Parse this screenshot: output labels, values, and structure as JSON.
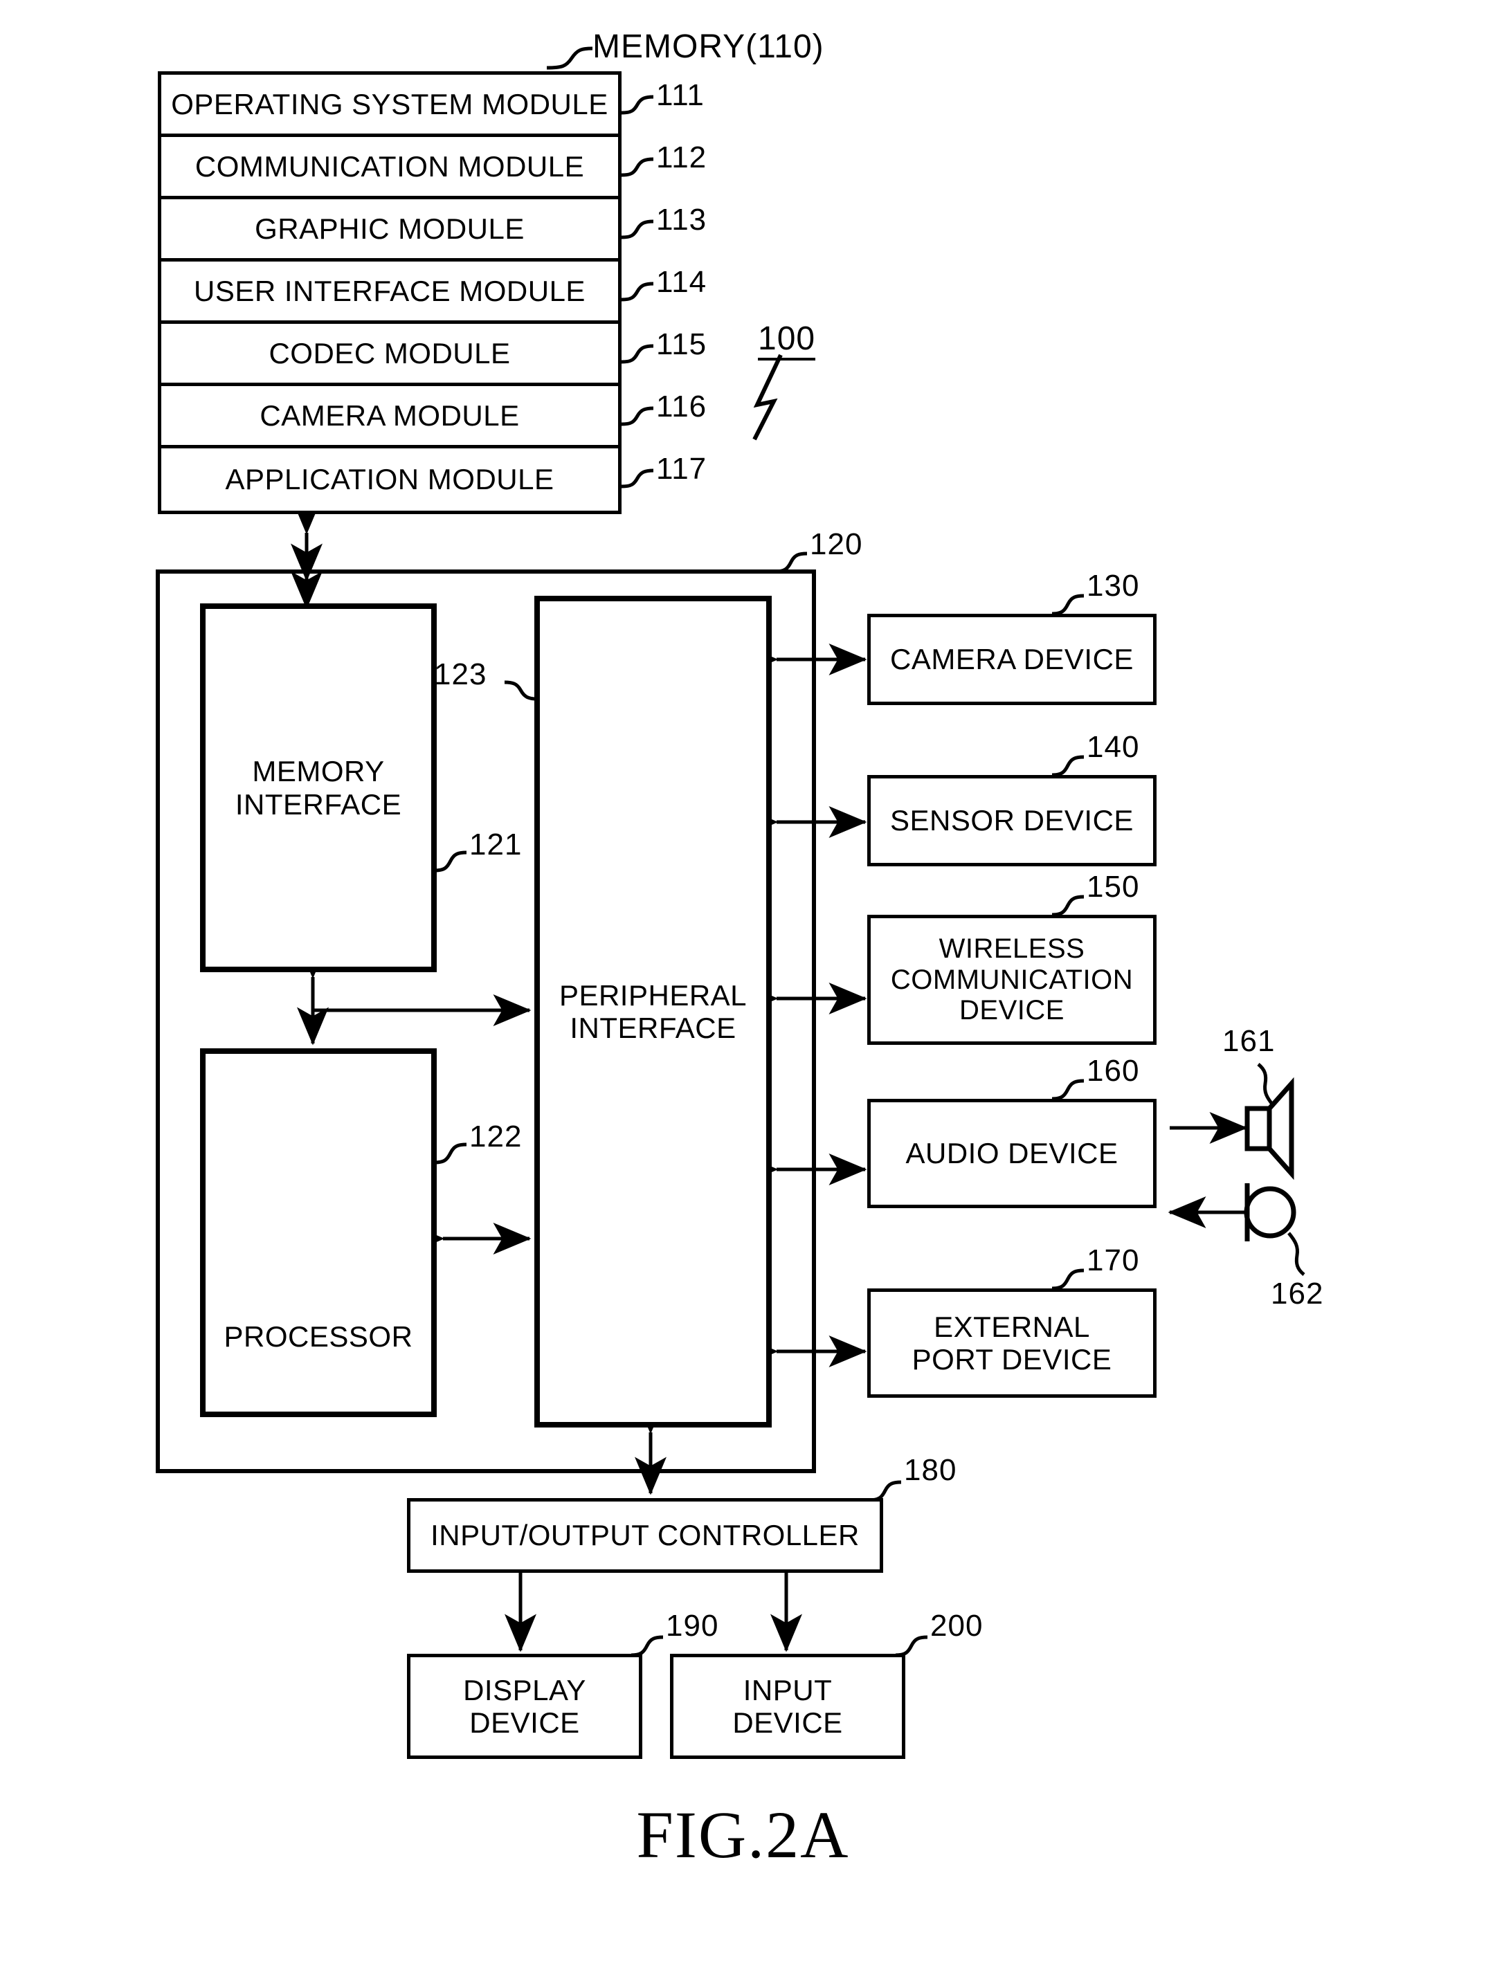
{
  "figure": {
    "caption": "FIG.2A",
    "system_ref": "100"
  },
  "memory": {
    "title": "MEMORY(110)",
    "modules": [
      {
        "label": "OPERATING SYSTEM MODULE",
        "ref": "111"
      },
      {
        "label": "COMMUNICATION MODULE",
        "ref": "112"
      },
      {
        "label": "GRAPHIC MODULE",
        "ref": "113"
      },
      {
        "label": "USER INTERFACE MODULE",
        "ref": "114"
      },
      {
        "label": "CODEC MODULE",
        "ref": "115"
      },
      {
        "label": "CAMERA MODULE",
        "ref": "116"
      },
      {
        "label": "APPLICATION MODULE",
        "ref": "117"
      }
    ]
  },
  "processor_unit": {
    "ref": "120",
    "memory_interface": {
      "label_line1": "MEMORY",
      "label_line2": "INTERFACE",
      "ref": "121"
    },
    "processor": {
      "label": "PROCESSOR",
      "ref": "122"
    },
    "peripheral_interface": {
      "label_line1": "PERIPHERAL",
      "label_line2": "INTERFACE",
      "ref": "123"
    }
  },
  "peripherals": [
    {
      "lines": [
        "CAMERA DEVICE"
      ],
      "ref": "130"
    },
    {
      "lines": [
        "SENSOR DEVICE"
      ],
      "ref": "140"
    },
    {
      "lines": [
        "WIRELESS",
        "COMMUNICATION",
        "DEVICE"
      ],
      "ref": "150"
    },
    {
      "lines": [
        "AUDIO DEVICE"
      ],
      "ref": "160"
    },
    {
      "lines": [
        "EXTERNAL",
        "PORT DEVICE"
      ],
      "ref": "170"
    }
  ],
  "audio_transducers": {
    "speaker": {
      "icon": "speaker-icon",
      "ref": "161"
    },
    "microphone": {
      "icon": "microphone-icon",
      "ref": "162"
    }
  },
  "io": {
    "controller": {
      "label": "INPUT/OUTPUT CONTROLLER",
      "ref": "180"
    },
    "display_device": {
      "line1": "DISPLAY",
      "line2": "DEVICE",
      "ref": "190"
    },
    "input_device": {
      "line1": "INPUT",
      "line2": "DEVICE",
      "ref": "200"
    }
  }
}
